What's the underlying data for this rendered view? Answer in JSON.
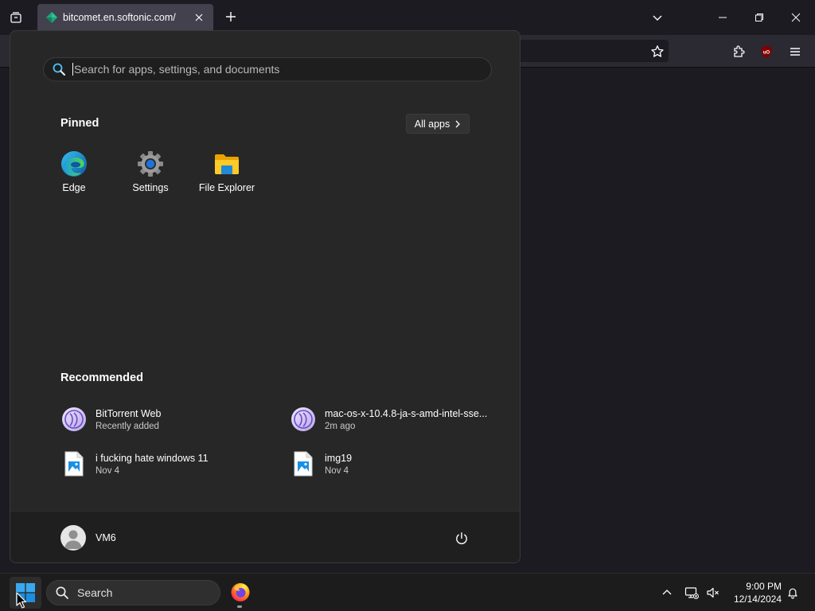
{
  "browser": {
    "tab": {
      "title": "bitcomet.en.softonic.com/"
    }
  },
  "start_menu": {
    "search": {
      "placeholder": "Search for apps, settings, and documents"
    },
    "pinned": {
      "title": "Pinned",
      "all_apps_label": "All apps",
      "apps": [
        {
          "label": "Edge",
          "icon": "edge-icon"
        },
        {
          "label": "Settings",
          "icon": "gear-icon"
        },
        {
          "label": "File Explorer",
          "icon": "folder-icon"
        }
      ]
    },
    "recommended": {
      "title": "Recommended",
      "items": [
        {
          "name": "BitTorrent Web",
          "sub": "Recently added",
          "icon": "bittorrent-icon"
        },
        {
          "name": "mac-os-x-10.4.8-ja-s-amd-intel-sse...",
          "sub": "2m ago",
          "icon": "bittorrent-icon"
        },
        {
          "name": "i fucking hate windows 11",
          "sub": "Nov 4",
          "icon": "image-file-icon"
        },
        {
          "name": "img19",
          "sub": "Nov 4",
          "icon": "image-file-icon"
        }
      ]
    },
    "footer": {
      "user_name": "VM6"
    }
  },
  "taskbar": {
    "search_label": "Search",
    "clock": {
      "time": "9:00 PM",
      "date": "12/14/2024"
    }
  },
  "colors": {
    "accent_blue": "#0078d4",
    "start_menu_bg": "#272727",
    "taskbar_bg": "#1c1c1c"
  }
}
